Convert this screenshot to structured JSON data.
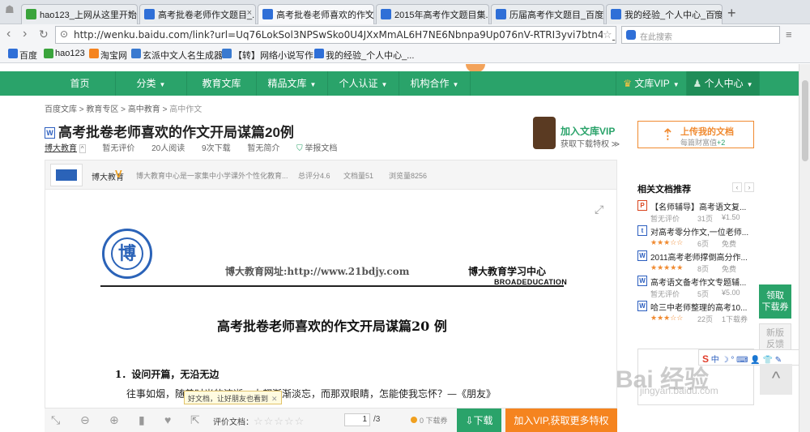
{
  "browser": {
    "tabs": [
      {
        "label": "hao123_上网从这里开始",
        "active": false
      },
      {
        "label": "高考批卷老师作文题目_...",
        "active": false
      },
      {
        "label": "高考批卷老师喜欢的作文...",
        "active": true
      },
      {
        "label": "2015年高考作文题目集...",
        "active": false
      },
      {
        "label": "历届高考作文题目_百度...",
        "active": false
      },
      {
        "label": "我的经验_个人中心_百度...",
        "active": false
      }
    ],
    "url": "http://wenku.baidu.com/link?url=Uq76LokSol3NPSwSko0U4JXxMmAL6H7NE6Nbnpa9Up076nV-RTRI3yvi7btn43_5P4elEsUwH5fl",
    "search_placeholder": "在此搜索",
    "bookmarks": [
      "百度",
      "hao123",
      "淘宝网",
      "玄派中文人名生成器...",
      "【转】网络小说写作...",
      "我的经验_个人中心_..."
    ]
  },
  "site_nav": {
    "items": [
      "首页",
      "分类",
      "教育文库",
      "精品文库",
      "个人认证",
      "机构合作"
    ],
    "vip_label": "文库VIP",
    "personal_label": "个人中心"
  },
  "breadcrumb": [
    "百度文库",
    "教育专区",
    "高中教育",
    "高中作文"
  ],
  "document": {
    "title": "高考批卷老师喜欢的作文开局谋篇20例",
    "publisher": "博大教育",
    "rating": "暂无评价",
    "reads": "20人阅读",
    "downloads": "9次下载",
    "summary": "暂无简介",
    "report": "举报文档"
  },
  "join_vip": {
    "title": "加入文库VIP",
    "subtitle": "获取下载特权 ≫"
  },
  "upload": {
    "title": "上传我的文档",
    "subtitle_prefix": "每篇财富值",
    "bonus": "+2"
  },
  "author_bar": {
    "name": "博大教育",
    "desc": "博大教育中心是一家集中小学课外个性化教育...",
    "score": "总评分4.6",
    "docs": "文档量51",
    "views": "浏览量8256"
  },
  "page_content": {
    "header_url": "博大教育网址:http://www.21bdjy.com",
    "center_name": "博大教育学习中心",
    "center_en": "BROADEDUCATION",
    "seal_char": "博",
    "heading": "高考批卷老师喜欢的作文开局谋篇20 例",
    "section1": "1．设问开篇，无沿无边",
    "para1": "往事如烟，随着时光的流逝，大都渐渐淡忘，而那双眼睛，怎能使我忘怀？—《朋友》"
  },
  "tooltip": "好文档，让好朋友也看到",
  "bottom": {
    "rate_label": "评价文档：",
    "page_current": "1",
    "page_total": "/3",
    "coupon": "0 下载券",
    "download_label": "下载",
    "vip_label": "加入VIP,获取更多特权"
  },
  "related": {
    "heading": "相关文档推荐",
    "items": [
      {
        "type": "P",
        "title": "【名师辅导】高考语文复...",
        "rating": "暂无评价",
        "pages": "31页",
        "price": "¥1.50"
      },
      {
        "type": "t",
        "title": "对高考零分作文,一位老师...",
        "rating": "★★★☆☆",
        "pages": "6页",
        "price": "免费"
      },
      {
        "type": "W",
        "title": "2011高考老师撑倒高分作...",
        "rating": "★★★★★",
        "pages": "8页",
        "price": "免费"
      },
      {
        "type": "W",
        "title": "高考语文备考作文专题辅...",
        "rating": "暂无评价",
        "pages": "5页",
        "price": "¥5.00"
      },
      {
        "type": "W",
        "title": "哈三中老师整理的高考10...",
        "rating": "★★★☆☆",
        "pages": "22页",
        "price": "1下载券"
      }
    ]
  },
  "side": {
    "get_coupon": "领取\n下载券",
    "new_version": "新版\n反馈"
  },
  "ime_bar": "中 ☽ ° ⌨ 👤 👕 ✎",
  "watermark": {
    "main": "Bai 经验",
    "sub": "jingyan.baidu.com"
  },
  "colors": {
    "brand_green": "#2aa36a",
    "orange": "#f5841f",
    "link_blue": "#2b5ebf"
  }
}
